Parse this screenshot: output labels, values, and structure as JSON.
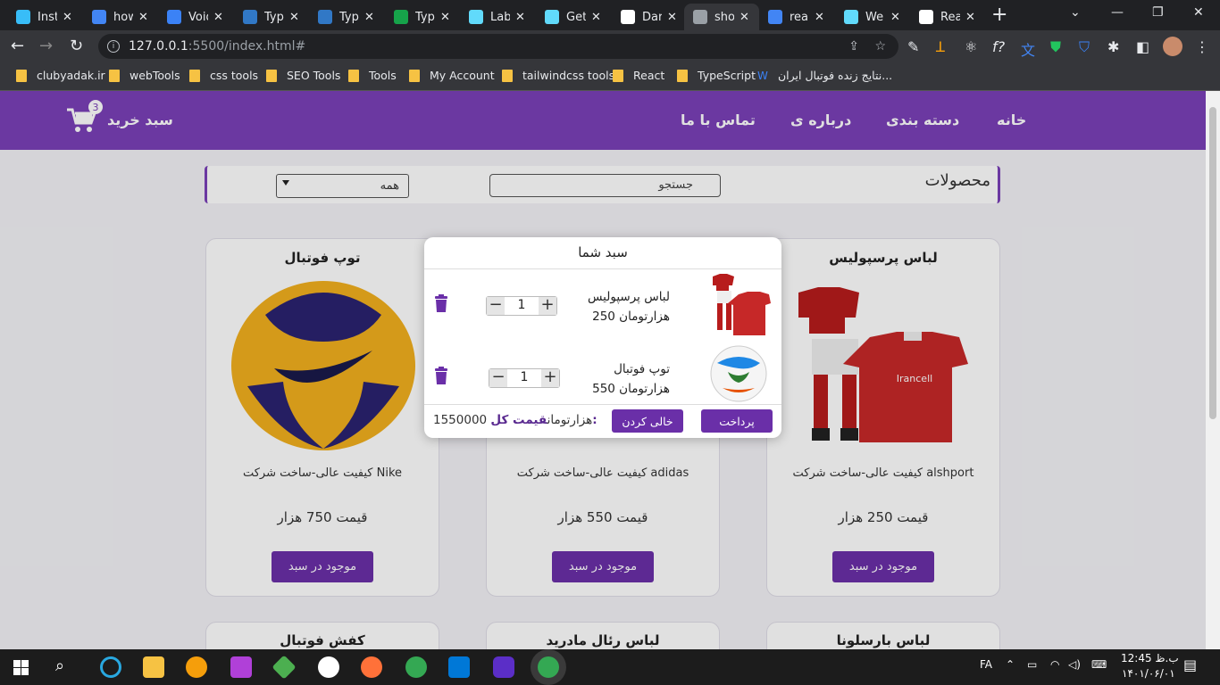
{
  "browser": {
    "tabs": [
      {
        "title": "Inst",
        "color": "#38bdf8"
      },
      {
        "title": "how",
        "color": "#4285f4"
      },
      {
        "title": "Void",
        "color": "#3b82f6"
      },
      {
        "title": "Typ",
        "color": "#3178c6"
      },
      {
        "title": "Typ",
        "color": "#3178c6"
      },
      {
        "title": "Typ",
        "color": "#16a34a"
      },
      {
        "title": "Lab",
        "color": "#61dafb"
      },
      {
        "title": "Get",
        "color": "#61dafb"
      },
      {
        "title": "Dar",
        "color": "#ffffff"
      },
      {
        "title": "sho",
        "color": "#9aa0a6"
      },
      {
        "title": "rea",
        "color": "#4285f4"
      },
      {
        "title": "We",
        "color": "#61dafb"
      },
      {
        "title": "Rea",
        "color": "#ffffff"
      }
    ],
    "url_host": "127.0.0.1",
    "url_rest": ":5500/index.html#",
    "bookmarks": [
      "clubyadak.ir",
      "webTools",
      "css tools",
      "SEO Tools",
      "Tools",
      "My Account",
      "tailwindcss tools",
      "React",
      "TypeScript",
      "نتایج زنده فوتبال ایران..."
    ]
  },
  "header": {
    "menu": [
      "خانه",
      "دسته بندی",
      "درباره ی",
      "تماس با ما"
    ],
    "cart_label": "سبد خرید",
    "cart_count": "3"
  },
  "filter": {
    "title": "محصولات",
    "search_placeholder": "جستجو",
    "select_value": "همه"
  },
  "products": [
    {
      "title": "لباس پرسپولیس",
      "desc": "کیفیت عالی-ساخت شرکت alshport",
      "price": "قیمت  250 هزار",
      "button": "موجود در سبد"
    },
    {
      "title": "",
      "desc": "کیفیت عالی-ساخت شرکت adidas",
      "price": "قیمت  550 هزار",
      "button": "موجود در سبد"
    },
    {
      "title": "توپ فوتبال",
      "desc": "کیفیت عالی-ساخت شرکت Nike",
      "price": "قیمت  750 هزار",
      "button": "موجود در سبد"
    }
  ],
  "products_row2": [
    "لباس بارسلونا",
    "لباس رئال مادرید",
    "کفش فوتبال"
  ],
  "cart_modal": {
    "title": "سبد شما",
    "items": [
      {
        "name": "لباس پرسپولیس",
        "price": "250 هزارتومان",
        "qty": "1"
      },
      {
        "name": "توپ فوتبال",
        "price": "550 هزارتومان",
        "qty": "1"
      }
    ],
    "pay_label": "پرداخت",
    "empty_label": "خالی کردن",
    "total_label": "قیمت کل:",
    "total_value": "1550000 هزارتومان"
  },
  "taskbar": {
    "lang": "FA",
    "time": "12:45 ب.ظ",
    "date": "۱۴۰۱/۰۶/۰۱"
  }
}
